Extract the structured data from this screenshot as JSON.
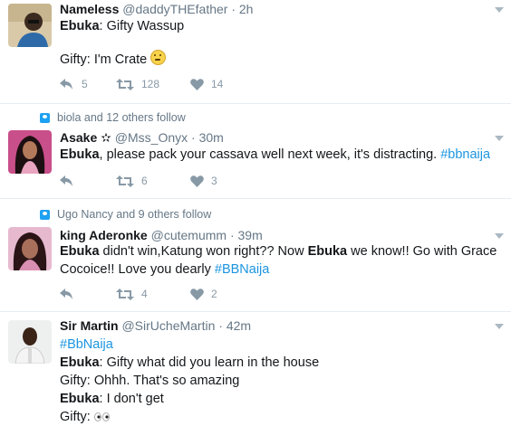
{
  "tweets": [
    {
      "name": "Nameless",
      "handle": "@daddyTHEfather",
      "time": "· 2h",
      "lines": {
        "l1_b": "Ebuka",
        "l1_t": ": Gifty Wassup",
        "l2_t": "Gifty: I'm Crate "
      },
      "counts": {
        "reply": "5",
        "retweet": "128",
        "like": "14"
      }
    },
    {
      "context": "biola and 12 others follow",
      "name": "Asake",
      "star": "✫",
      "handle": "@Mss_Onyx",
      "time": "· 30m",
      "lines": {
        "l1_b": "Ebuka",
        "l1_t": ", please pack your cassava well next week, it's distracting. ",
        "l1_hash": "#bbnaija"
      },
      "counts": {
        "reply": "",
        "retweet": "6",
        "like": "3"
      }
    },
    {
      "context": "Ugo Nancy and 9 others follow",
      "name": "king Aderonke",
      "handle": "@cutemumm",
      "time": "· 39m",
      "lines": {
        "l1_b": "Ebuka",
        "l1_t": " didn't win,Katung won right?? Now ",
        "l1_b2": "Ebuka",
        "l1_t2": " we know!!  Go with Grace",
        "l2_t": "Cocoice!! Love you dearly ",
        "l2_hash": "#BBNaija"
      },
      "counts": {
        "reply": "",
        "retweet": "4",
        "like": "2"
      }
    },
    {
      "name": "Sir Martin",
      "handle": "@SirUcheMartin",
      "time": "· 42m",
      "lines": {
        "l0_hash": "#BbNaija",
        "l1_b": "Ebuka",
        "l1_t": ": Gifty what did you learn in the house",
        "l2_t": "Gifty: Ohhh. That's so amazing",
        "l3_b": "Ebuka",
        "l3_t": ": I don't get",
        "l4_t": "Gifty: "
      }
    }
  ],
  "colors": {
    "link": "#1b95e0",
    "muted": "#657786",
    "icon": "#8899a6",
    "divider": "#e6ecf0"
  }
}
